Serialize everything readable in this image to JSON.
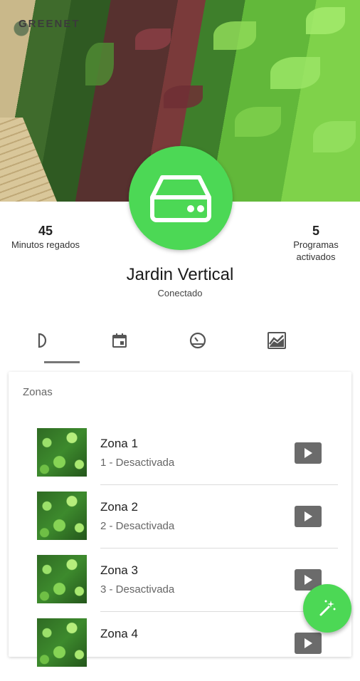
{
  "header": {
    "brand": "GREENET"
  },
  "colors": {
    "accent": "#4cd855",
    "play_button": "#6b6b6b"
  },
  "stats": {
    "left": {
      "value": "45",
      "label": "Minutos regados"
    },
    "right": {
      "value": "5",
      "label": "Programas activados"
    }
  },
  "device": {
    "icon": "storage-device-icon",
    "name": "Jardin Vertical",
    "status": "Conectado"
  },
  "tabs": [
    {
      "icon": "zones-tab-icon",
      "selected": true
    },
    {
      "icon": "calendar-icon",
      "selected": false
    },
    {
      "icon": "speedometer-icon",
      "selected": false
    },
    {
      "icon": "chart-icon",
      "selected": false
    }
  ],
  "zones_card": {
    "title": "Zonas",
    "zones": [
      {
        "name": "Zona 1",
        "status": "1 - Desactivada",
        "action_icon": "play-icon"
      },
      {
        "name": "Zona 2",
        "status": "2 - Desactivada",
        "action_icon": "play-icon"
      },
      {
        "name": "Zona 3",
        "status": "3 - Desactivada",
        "action_icon": "play-icon"
      },
      {
        "name": "Zona 4",
        "status": "",
        "action_icon": "play-icon"
      }
    ]
  },
  "fab": {
    "icon": "magic-wand-icon"
  }
}
